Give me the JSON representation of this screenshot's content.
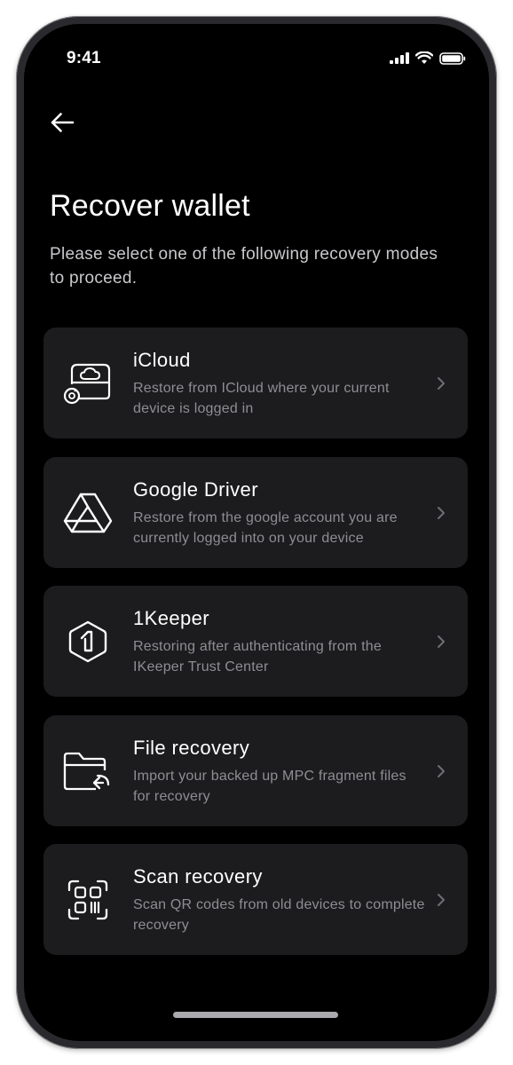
{
  "status_bar": {
    "time": "9:41",
    "icons": [
      "signal-icon",
      "wifi-icon",
      "battery-icon"
    ]
  },
  "header": {
    "back_icon": "arrow-left-icon",
    "title": "Recover wallet",
    "subtitle": "Please select one of the following recovery modes to proceed."
  },
  "options": [
    {
      "icon": "icloud-drive-icon",
      "title": "iCloud",
      "description": "Restore from ICloud where your current device is logged in"
    },
    {
      "icon": "google-drive-icon",
      "title": "Google Driver",
      "description": "Restore from the google account you are currently logged into on your device"
    },
    {
      "icon": "keeper-icon",
      "title": "1Keeper",
      "description": "Restoring after authenticating from the IKeeper Trust Center"
    },
    {
      "icon": "folder-import-icon",
      "title": "File recovery",
      "description": "Import your backed up MPC fragment files for recovery"
    },
    {
      "icon": "qr-scan-icon",
      "title": "Scan recovery",
      "description": "Scan QR codes from old devices to complete recovery"
    }
  ],
  "colors": {
    "background": "#000000",
    "card": "#1c1c1e",
    "title_text": "#ffffff",
    "secondary_text": "#8e8e93"
  }
}
